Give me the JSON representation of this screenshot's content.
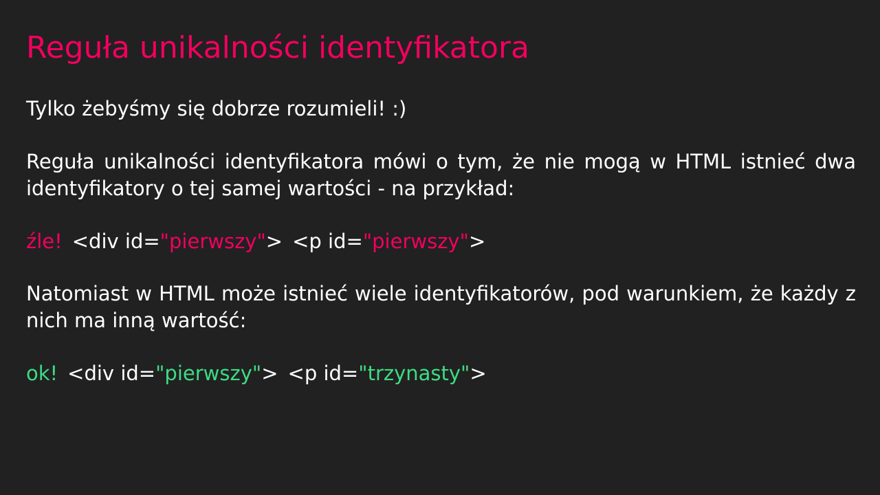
{
  "slide": {
    "title": "Reguła unikalności identyfikatora",
    "intro": "Tylko żebyśmy się dobrze rozumieli! :)",
    "rule_text": "Reguła unikalności identyfikatora mówi o tym, że nie mogą w HTML istnieć dwa identyfikatory o tej samej wartości - na przykład:",
    "bad_example": {
      "label": "źle!",
      "div_open": "<div id=",
      "div_value": "\"pierwszy\"",
      "div_close": ">",
      "p_open": "<p id=",
      "p_value": "\"pierwszy\"",
      "p_close": ">"
    },
    "but_text": "Natomiast w HTML może istnieć wiele identyfikatorów, pod warunkiem, że każdy z nich ma inną wartość:",
    "good_example": {
      "label": "ok!",
      "div_open": "<div id=",
      "div_value": "\"pierwszy\"",
      "div_close": ">",
      "p_open": "<p id=",
      "p_value": "\"trzynasty\"",
      "p_close": ">"
    },
    "colors": {
      "background": "#212121",
      "text": "#ffffff",
      "accent_bad": "#f2005f",
      "accent_good": "#3ddc84"
    }
  }
}
